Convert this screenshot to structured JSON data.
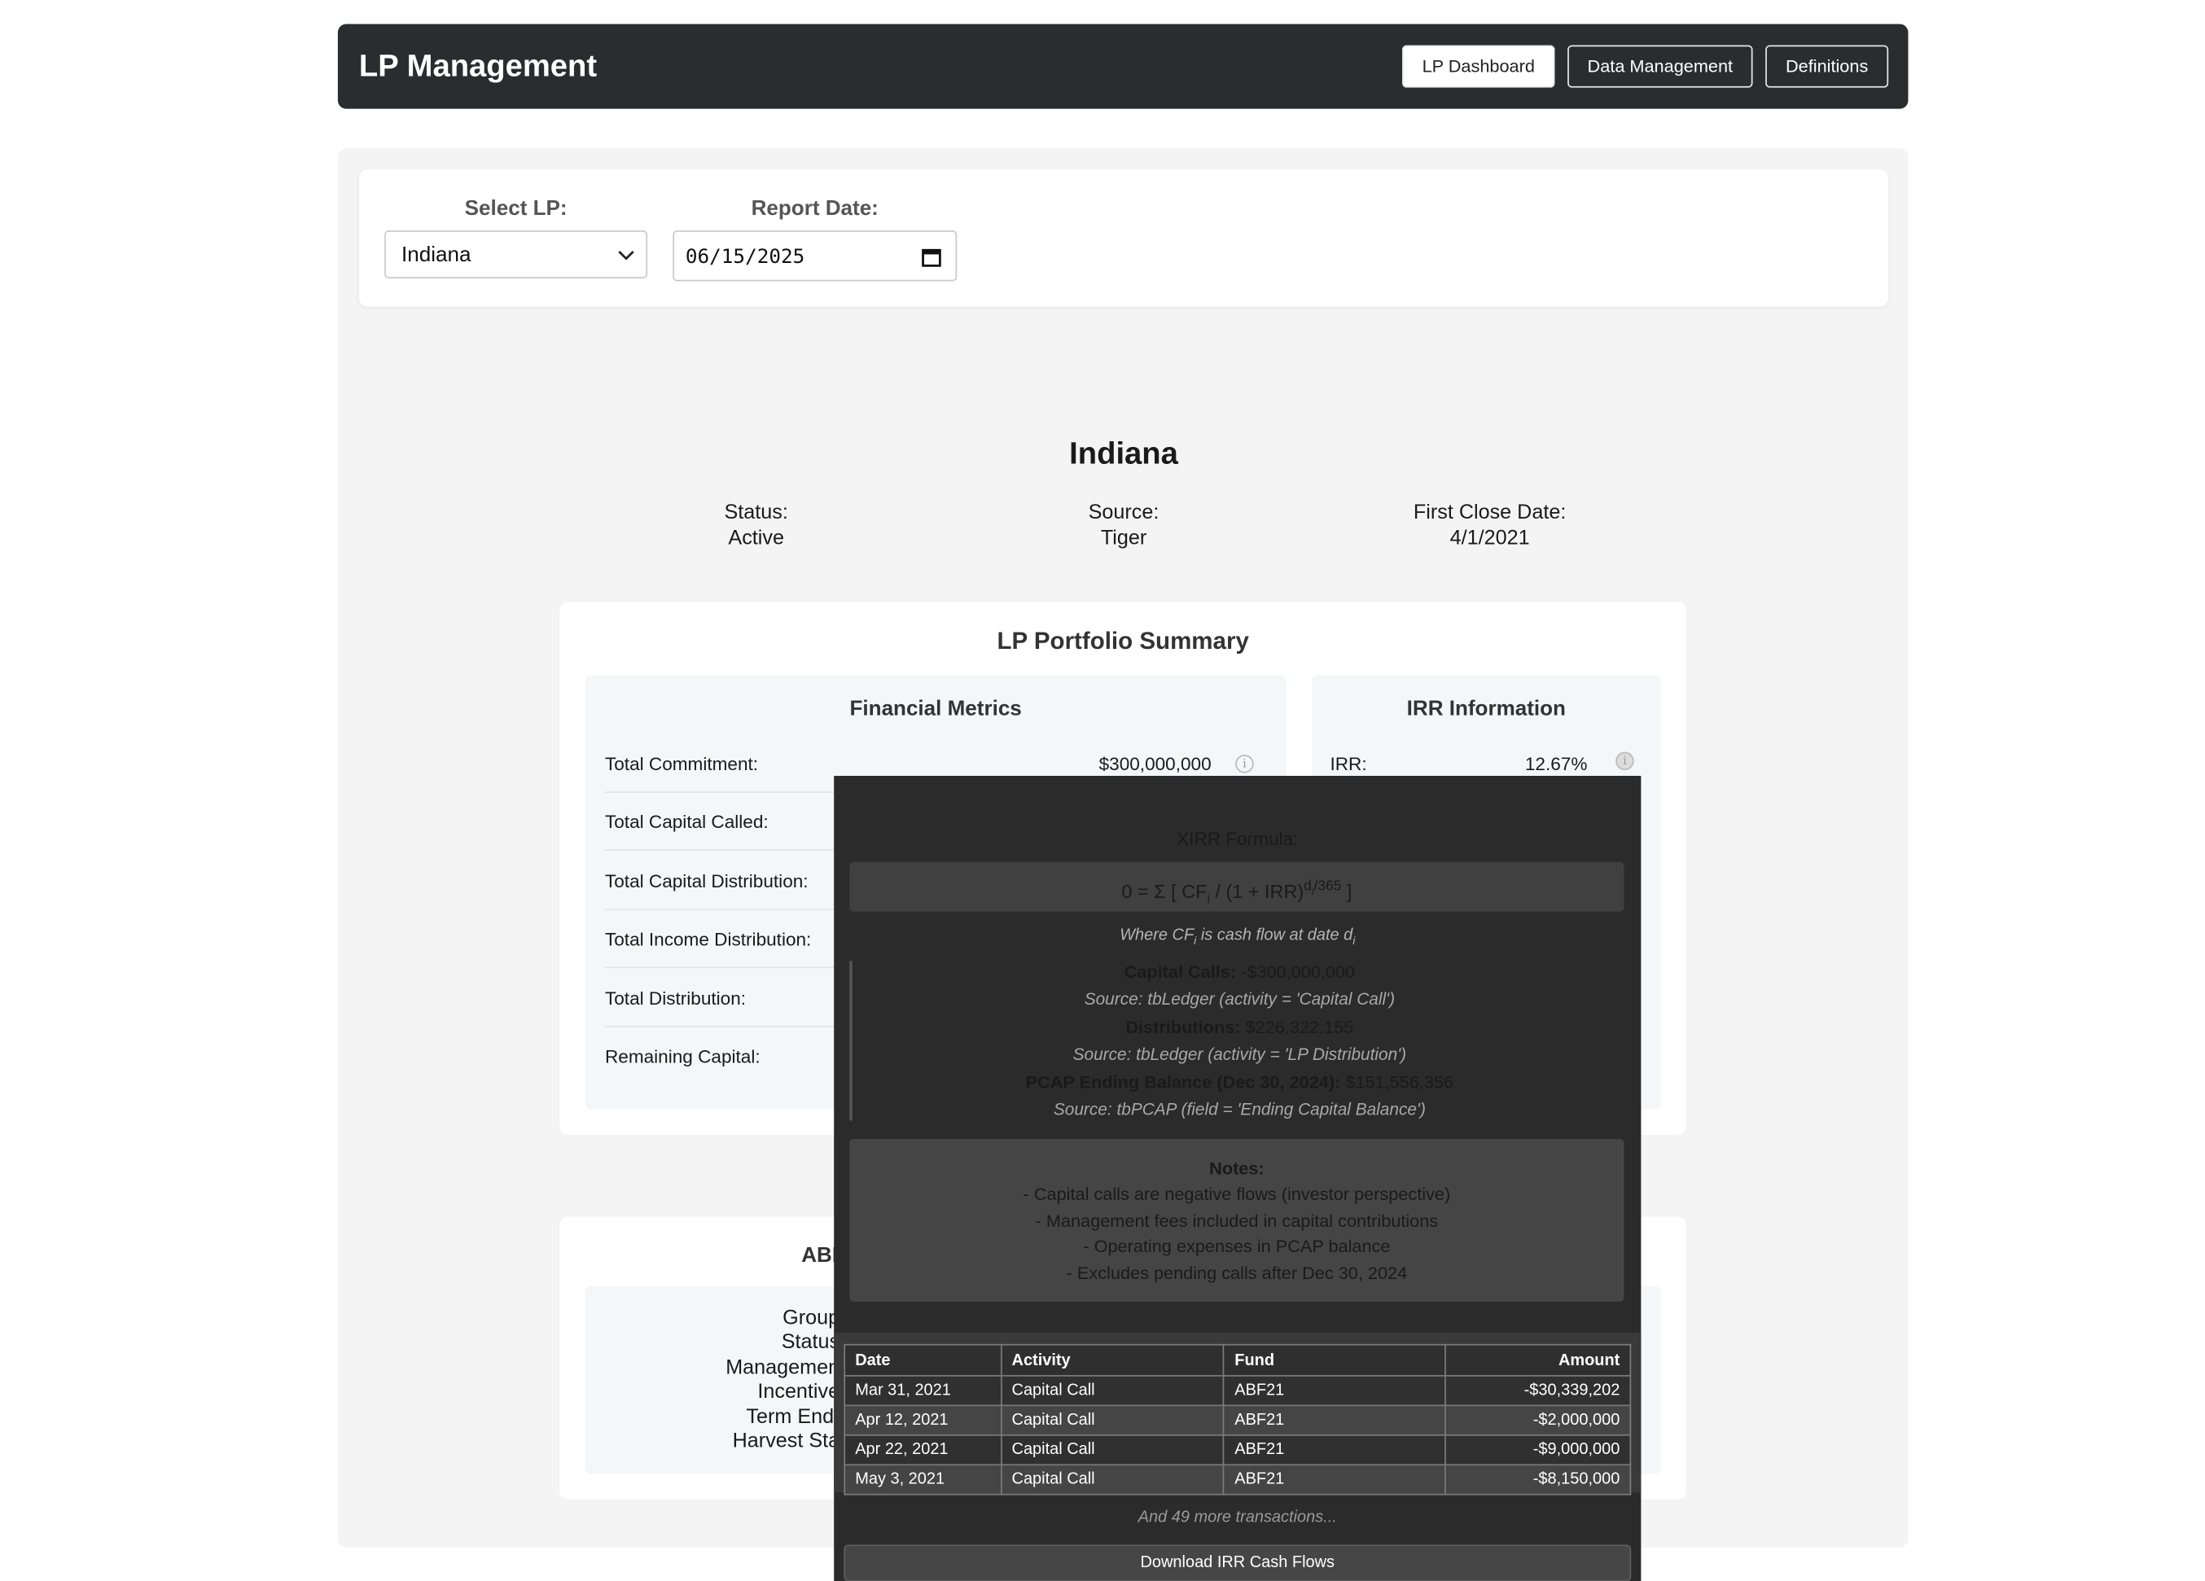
{
  "header": {
    "title": "LP Management",
    "nav": [
      {
        "label": "LP Dashboard",
        "active": true
      },
      {
        "label": "Data Management",
        "active": false
      },
      {
        "label": "Definitions",
        "active": false
      }
    ]
  },
  "filters": {
    "lp_label": "Select LP:",
    "lp_value": "Indiana",
    "date_label": "Report Date:",
    "date_value": "06/15/2025"
  },
  "lp": {
    "name": "Indiana",
    "status_label": "Status:",
    "status": "Active",
    "source_label": "Source:",
    "source": "Tiger",
    "first_close_label": "First Close Date:",
    "first_close": "4/1/2021"
  },
  "summary": {
    "title": "LP Portfolio Summary",
    "financial_title": "Financial Metrics",
    "metrics": [
      {
        "label": "Total Commitment:",
        "value": "$300,000,000"
      },
      {
        "label": "Total Capital Called:",
        "value": ""
      },
      {
        "label": "Total Capital Distribution:",
        "value": ""
      },
      {
        "label": "Total Income Distribution:",
        "value": ""
      },
      {
        "label": "Total Distribution:",
        "value": ""
      },
      {
        "label": "Remaining Capital:",
        "value": ""
      }
    ],
    "irr_title": "IRR Information",
    "irr_label": "IRR:",
    "irr_value": "12.67%"
  },
  "fund_card": {
    "title_partial": "ABI",
    "lines": [
      "Group",
      "Status",
      "Managemen",
      "Incentive",
      "Term End:",
      "Harvest Sta"
    ]
  },
  "tooltip": {
    "heading": "XIRR Formula:",
    "formula": {
      "lhs": "0 = Σ [ CF",
      "i": "i",
      "mid": " / (1 + IRR)",
      "d": "d",
      "exp_tail": "/365",
      "end": " ]"
    },
    "where_text": "Where CF",
    "where_mid": " is cash flow at date d",
    "capital_calls_label": "Capital Calls:",
    "capital_calls_value": "-$300,000,000",
    "capital_calls_source": "Source: tbLedger (activity = 'Capital Call')",
    "distributions_label": "Distributions:",
    "distributions_value": "$226,322,155",
    "distributions_source": "Source: tbLedger (activity = 'LP Distribution')",
    "pcap_label": "PCAP Ending Balance (Dec 30, 2024):",
    "pcap_value": "$151,556,356",
    "pcap_source": "Source: tbPCAP (field = 'Ending Capital Balance')",
    "notes_title": "Notes:",
    "notes": [
      "- Capital calls are negative flows (investor perspective)",
      "- Management fees included in capital contributions",
      "- Operating expenses in PCAP balance",
      "- Excludes pending calls after Dec 30, 2024"
    ],
    "table": {
      "columns": [
        "Date",
        "Activity",
        "Fund",
        "Amount"
      ],
      "rows": [
        [
          "Mar 31, 2021",
          "Capital Call",
          "ABF21",
          "-$30,339,202"
        ],
        [
          "Apr 12, 2021",
          "Capital Call",
          "ABF21",
          "-$2,000,000"
        ],
        [
          "Apr 22, 2021",
          "Capital Call",
          "ABF21",
          "-$9,000,000"
        ],
        [
          "May 3, 2021",
          "Capital Call",
          "ABF21",
          "-$8,150,000"
        ]
      ]
    },
    "more_text": "And 49 more transactions...",
    "download_label": "Download IRR Cash Flows"
  }
}
